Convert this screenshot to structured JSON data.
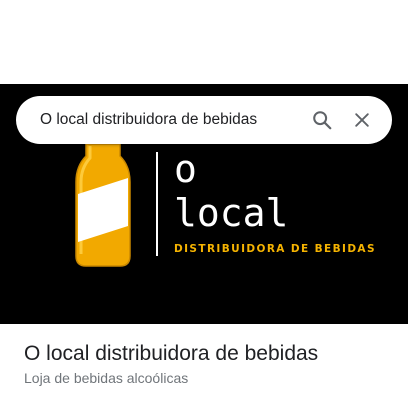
{
  "search": {
    "query": "O local distribuidora de bebidas"
  },
  "icons": {
    "search": "search-icon",
    "close": "close-icon"
  },
  "hero_logo": {
    "word_o": "o",
    "word_local": "local",
    "subtitle": "DISTRIBUIDORA DE BEBIDAS",
    "colors": {
      "background": "#000000",
      "subtitle": "#f5b301",
      "bottle": "#f2a900",
      "label": "#ffffff"
    }
  },
  "place": {
    "title": "O local distribuidora de bebidas",
    "category": "Loja de bebidas alcoólicas"
  }
}
